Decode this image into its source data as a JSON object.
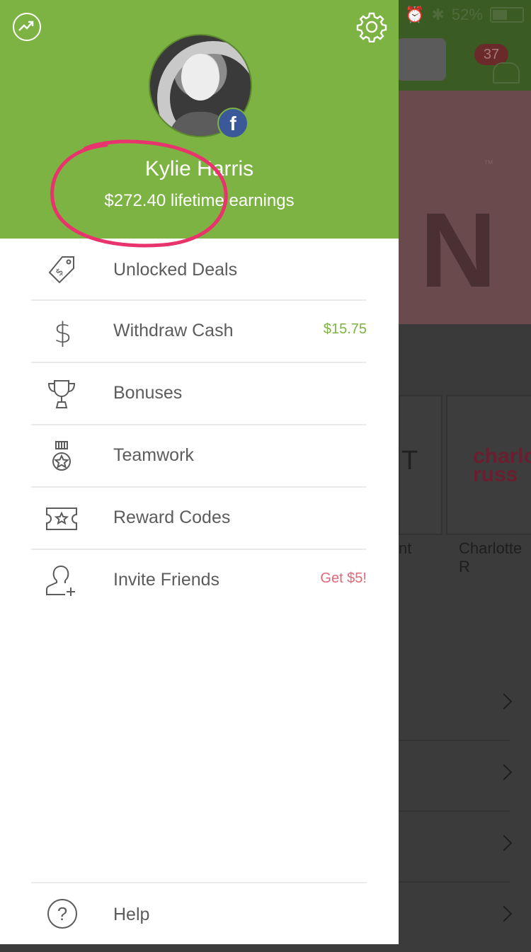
{
  "status_bar": {
    "battery": "52%"
  },
  "background_app": {
    "notification_count": "37",
    "store_captions": [
      "nt",
      "Charlotte R"
    ],
    "store_logo_text": "charlo russ",
    "card_letter": "T"
  },
  "drawer": {
    "user": {
      "name": "Kylie Harris",
      "earnings": "$272.40 lifetime earnings"
    },
    "menu": [
      {
        "label": "Unlocked Deals",
        "icon": "price-tag-icon",
        "extra": ""
      },
      {
        "label": "Withdraw Cash",
        "icon": "dollar-icon",
        "extra": "$15.75"
      },
      {
        "label": "Bonuses",
        "icon": "trophy-icon",
        "extra": ""
      },
      {
        "label": "Teamwork",
        "icon": "medal-icon",
        "extra": ""
      },
      {
        "label": "Reward Codes",
        "icon": "ticket-icon",
        "extra": ""
      },
      {
        "label": "Invite Friends",
        "icon": "add-friend-icon",
        "extra": "Get $5!"
      }
    ],
    "help": {
      "label": "Help",
      "icon_glyph": "?"
    },
    "facebook_glyph": "f"
  },
  "colors": {
    "header_green": "#7cb342",
    "accent_green": "#7cb342",
    "invite_pink": "#e0687a",
    "highlight_circle": "#e8336d",
    "facebook_blue": "#3b5998"
  }
}
